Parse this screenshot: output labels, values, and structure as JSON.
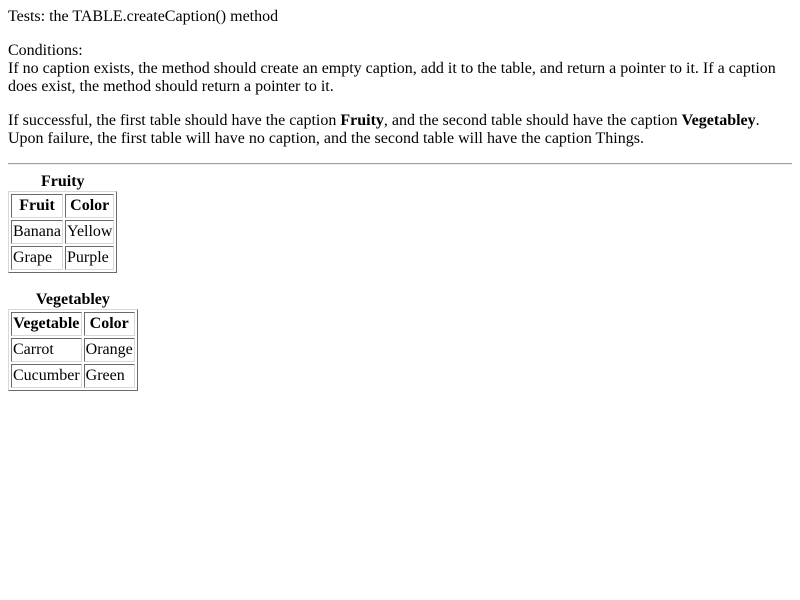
{
  "title": "Tests: the TABLE.createCaption() method",
  "conditions": {
    "heading": "Conditions:",
    "text": "If no caption exists, the method should create an empty caption, add it to the table, and return a pointer to it. If a caption does exist, the method should return a pointer to it."
  },
  "result": {
    "part1": "If successful, the first table should have the caption ",
    "caption1": "Fruity",
    "part2": ", and the second table should have the caption ",
    "caption2": "Vegetabley",
    "part3": ". Upon failure, the first table will have no caption, and the second table will have the caption Things."
  },
  "table1": {
    "caption": "Fruity",
    "headers": [
      "Fruit",
      "Color"
    ],
    "rows": [
      [
        "Banana",
        "Yellow"
      ],
      [
        "Grape",
        "Purple"
      ]
    ]
  },
  "table2": {
    "caption": "Vegetabley",
    "headers": [
      "Vegetable",
      "Color"
    ],
    "rows": [
      [
        "Carrot",
        "Orange"
      ],
      [
        "Cucumber",
        "Green"
      ]
    ]
  }
}
